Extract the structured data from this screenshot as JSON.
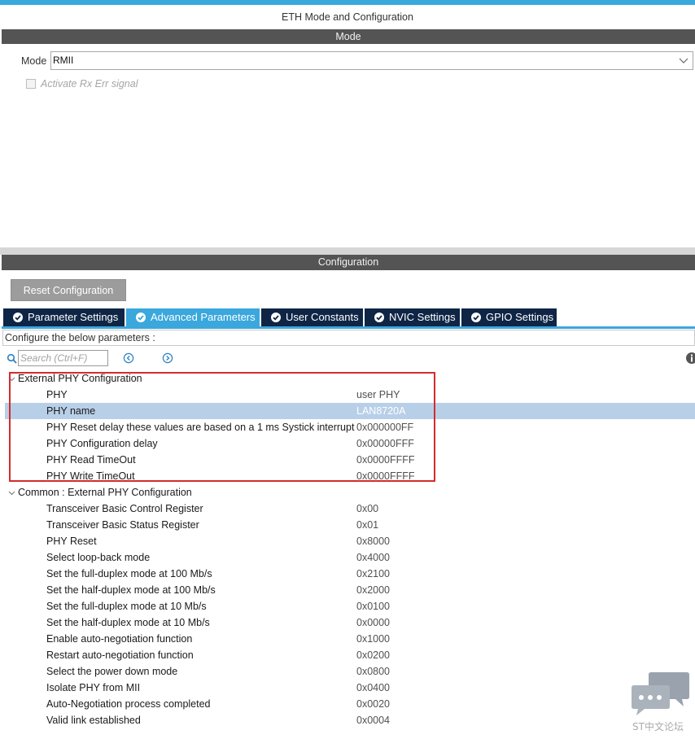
{
  "window": {
    "title": "ETH Mode and Configuration"
  },
  "mode_section": {
    "header": "Mode",
    "mode_label": "Mode",
    "mode_value": "RMII",
    "checkbox_label": "Activate Rx Err signal",
    "checkbox_checked": false
  },
  "config_section": {
    "header": "Configuration",
    "reset_button": "Reset Configuration",
    "tabs": [
      {
        "label": "Parameter Settings",
        "active": false
      },
      {
        "label": "Advanced Parameters",
        "active": true
      },
      {
        "label": "User Constants",
        "active": false
      },
      {
        "label": "NVIC Settings",
        "active": false
      },
      {
        "label": "GPIO Settings",
        "active": false
      }
    ],
    "instructions": "Configure the below parameters :",
    "search_placeholder": "Search (Ctrl+F)"
  },
  "groups": [
    {
      "title": "External PHY Configuration",
      "expanded": true,
      "rows": [
        {
          "name": "PHY",
          "value": "user PHY"
        },
        {
          "name": "PHY name",
          "value": "LAN8720A",
          "selected": true
        },
        {
          "name": "PHY Reset delay these values are based on a 1 ms Systick interrupt",
          "value": "0x000000FF"
        },
        {
          "name": "PHY Configuration delay",
          "value": "0x00000FFF"
        },
        {
          "name": "PHY Read TimeOut",
          "value": "0x0000FFFF"
        },
        {
          "name": "PHY Write TimeOut",
          "value": "0x0000FFFF"
        }
      ]
    },
    {
      "title": "Common : External PHY Configuration",
      "expanded": true,
      "rows": [
        {
          "name": "Transceiver Basic Control Register",
          "value": "0x00"
        },
        {
          "name": "Transceiver Basic Status Register",
          "value": "0x01"
        },
        {
          "name": "PHY Reset",
          "value": "0x8000"
        },
        {
          "name": "Select loop-back mode",
          "value": "0x4000"
        },
        {
          "name": "Set the full-duplex mode at 100 Mb/s",
          "value": "0x2100"
        },
        {
          "name": "Set the half-duplex mode at 100 Mb/s",
          "value": "0x2000"
        },
        {
          "name": "Set the full-duplex mode at 10 Mb/s",
          "value": "0x0100"
        },
        {
          "name": "Set the half-duplex mode at 10 Mb/s",
          "value": "0x0000"
        },
        {
          "name": "Enable auto-negotiation function",
          "value": "0x1000"
        },
        {
          "name": "Restart auto-negotiation function",
          "value": "0x0200"
        },
        {
          "name": "Select the power down mode",
          "value": "0x0800"
        },
        {
          "name": "Isolate PHY from MII",
          "value": "0x0400"
        },
        {
          "name": "Auto-Negotiation process completed",
          "value": "0x0020"
        },
        {
          "name": "Valid link established",
          "value": "0x0004"
        }
      ]
    }
  ],
  "watermark": {
    "text": "ST中文论坛"
  },
  "colors": {
    "accent": "#39a9dc",
    "tab_inactive": "#0e2546",
    "section_bar": "#545454",
    "selected_row": "#b8cfe8",
    "highlight_box": "#d52b2b"
  }
}
